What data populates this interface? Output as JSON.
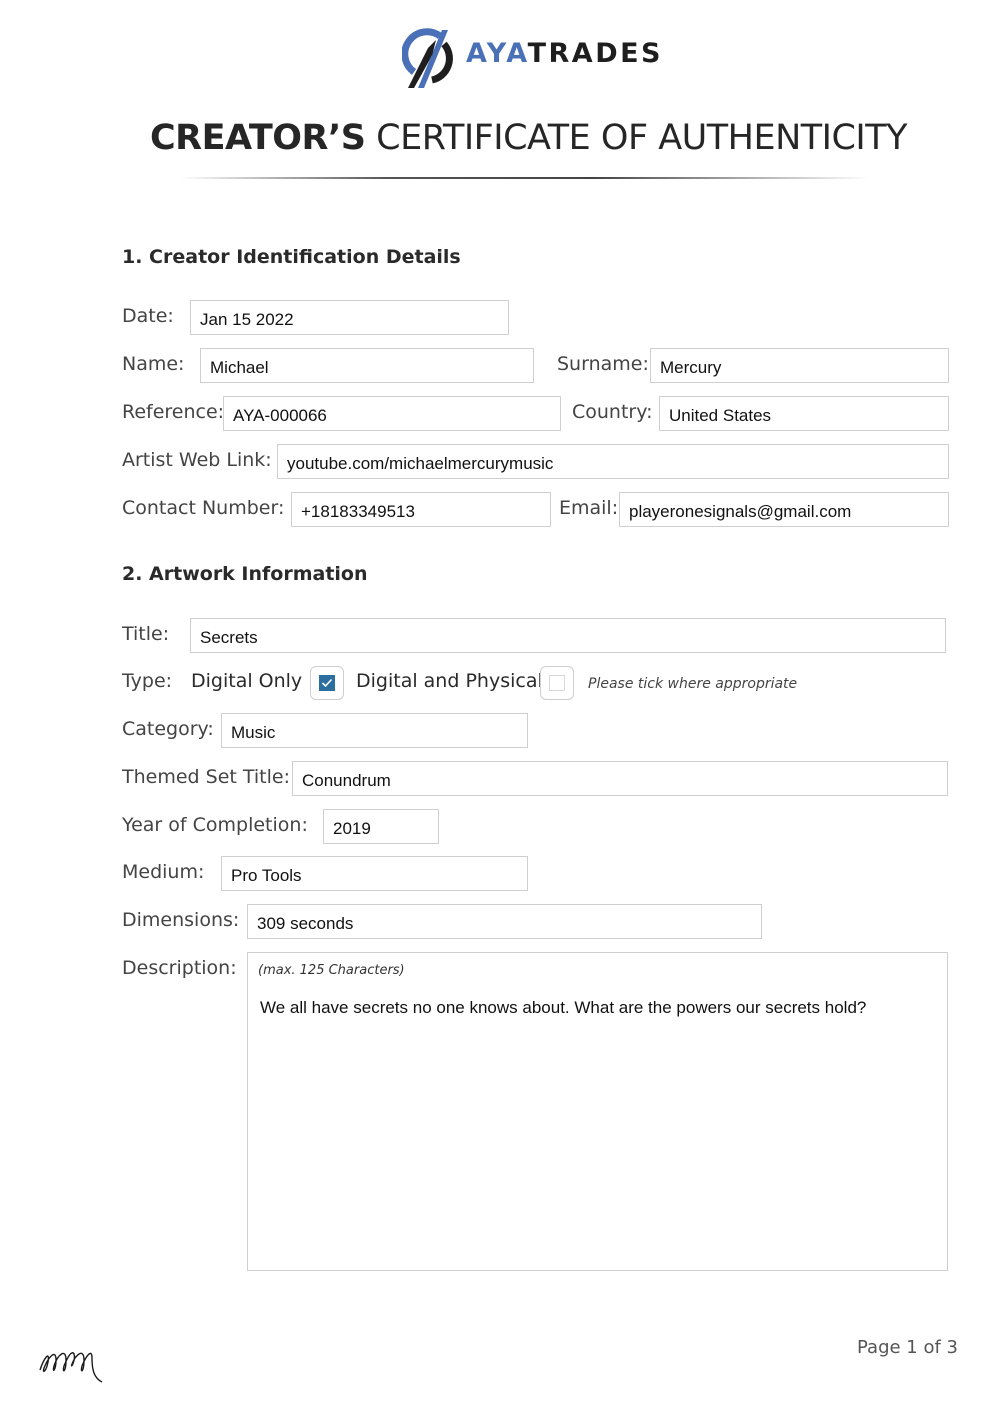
{
  "brand": {
    "name_accent": "AYA",
    "name_rest": "TRADES",
    "accent_color": "#4a70b8",
    "logo_icon": "ayatrades-logo-icon"
  },
  "header": {
    "title_bold": "CREATOR’S",
    "title_light": "CERTIFICATE OF AUTHENTICITY"
  },
  "section1": {
    "heading": "1. Creator Identification Details",
    "date": {
      "label": "Date:",
      "value": "Jan 15 2022"
    },
    "name": {
      "label": "Name:",
      "value": "Michael"
    },
    "surname": {
      "label": "Surname:",
      "value": "Mercury"
    },
    "reference": {
      "label": "Reference:",
      "value": "AYA-000066"
    },
    "country": {
      "label": "Country:",
      "value": "United States"
    },
    "web_link": {
      "label": "Artist Web Link:",
      "value": "youtube.com/michaelmercurymusic"
    },
    "contact": {
      "label": "Contact Number:",
      "value": "+18183349513"
    },
    "email": {
      "label": "Email:",
      "value": "playeronesignals@gmail.com"
    }
  },
  "section2": {
    "heading": "2. Artwork Information",
    "title": {
      "label": "Title:",
      "value": "Secrets"
    },
    "type": {
      "label": "Type:",
      "options": [
        {
          "label": "Digital Only",
          "checked": true
        },
        {
          "label": "Digital and Physical",
          "checked": false
        }
      ],
      "hint": "Please tick where appropriate"
    },
    "category": {
      "label": "Category:",
      "value": "Music"
    },
    "themed_set": {
      "label": "Themed Set Title:",
      "value": "Conundrum"
    },
    "year": {
      "label": "Year of Completion:",
      "value": "2019"
    },
    "medium": {
      "label": "Medium:",
      "value": "Pro Tools"
    },
    "dimensions": {
      "label": "Dimensions:",
      "value": "309 seconds"
    },
    "description": {
      "label": "Description:",
      "hint": "(max. 125 Characters)",
      "value": "We all have secrets no one knows about. What are the powers our secrets hold?"
    }
  },
  "footer": {
    "signature": "MM",
    "page_label": "Page 1 of 3"
  }
}
